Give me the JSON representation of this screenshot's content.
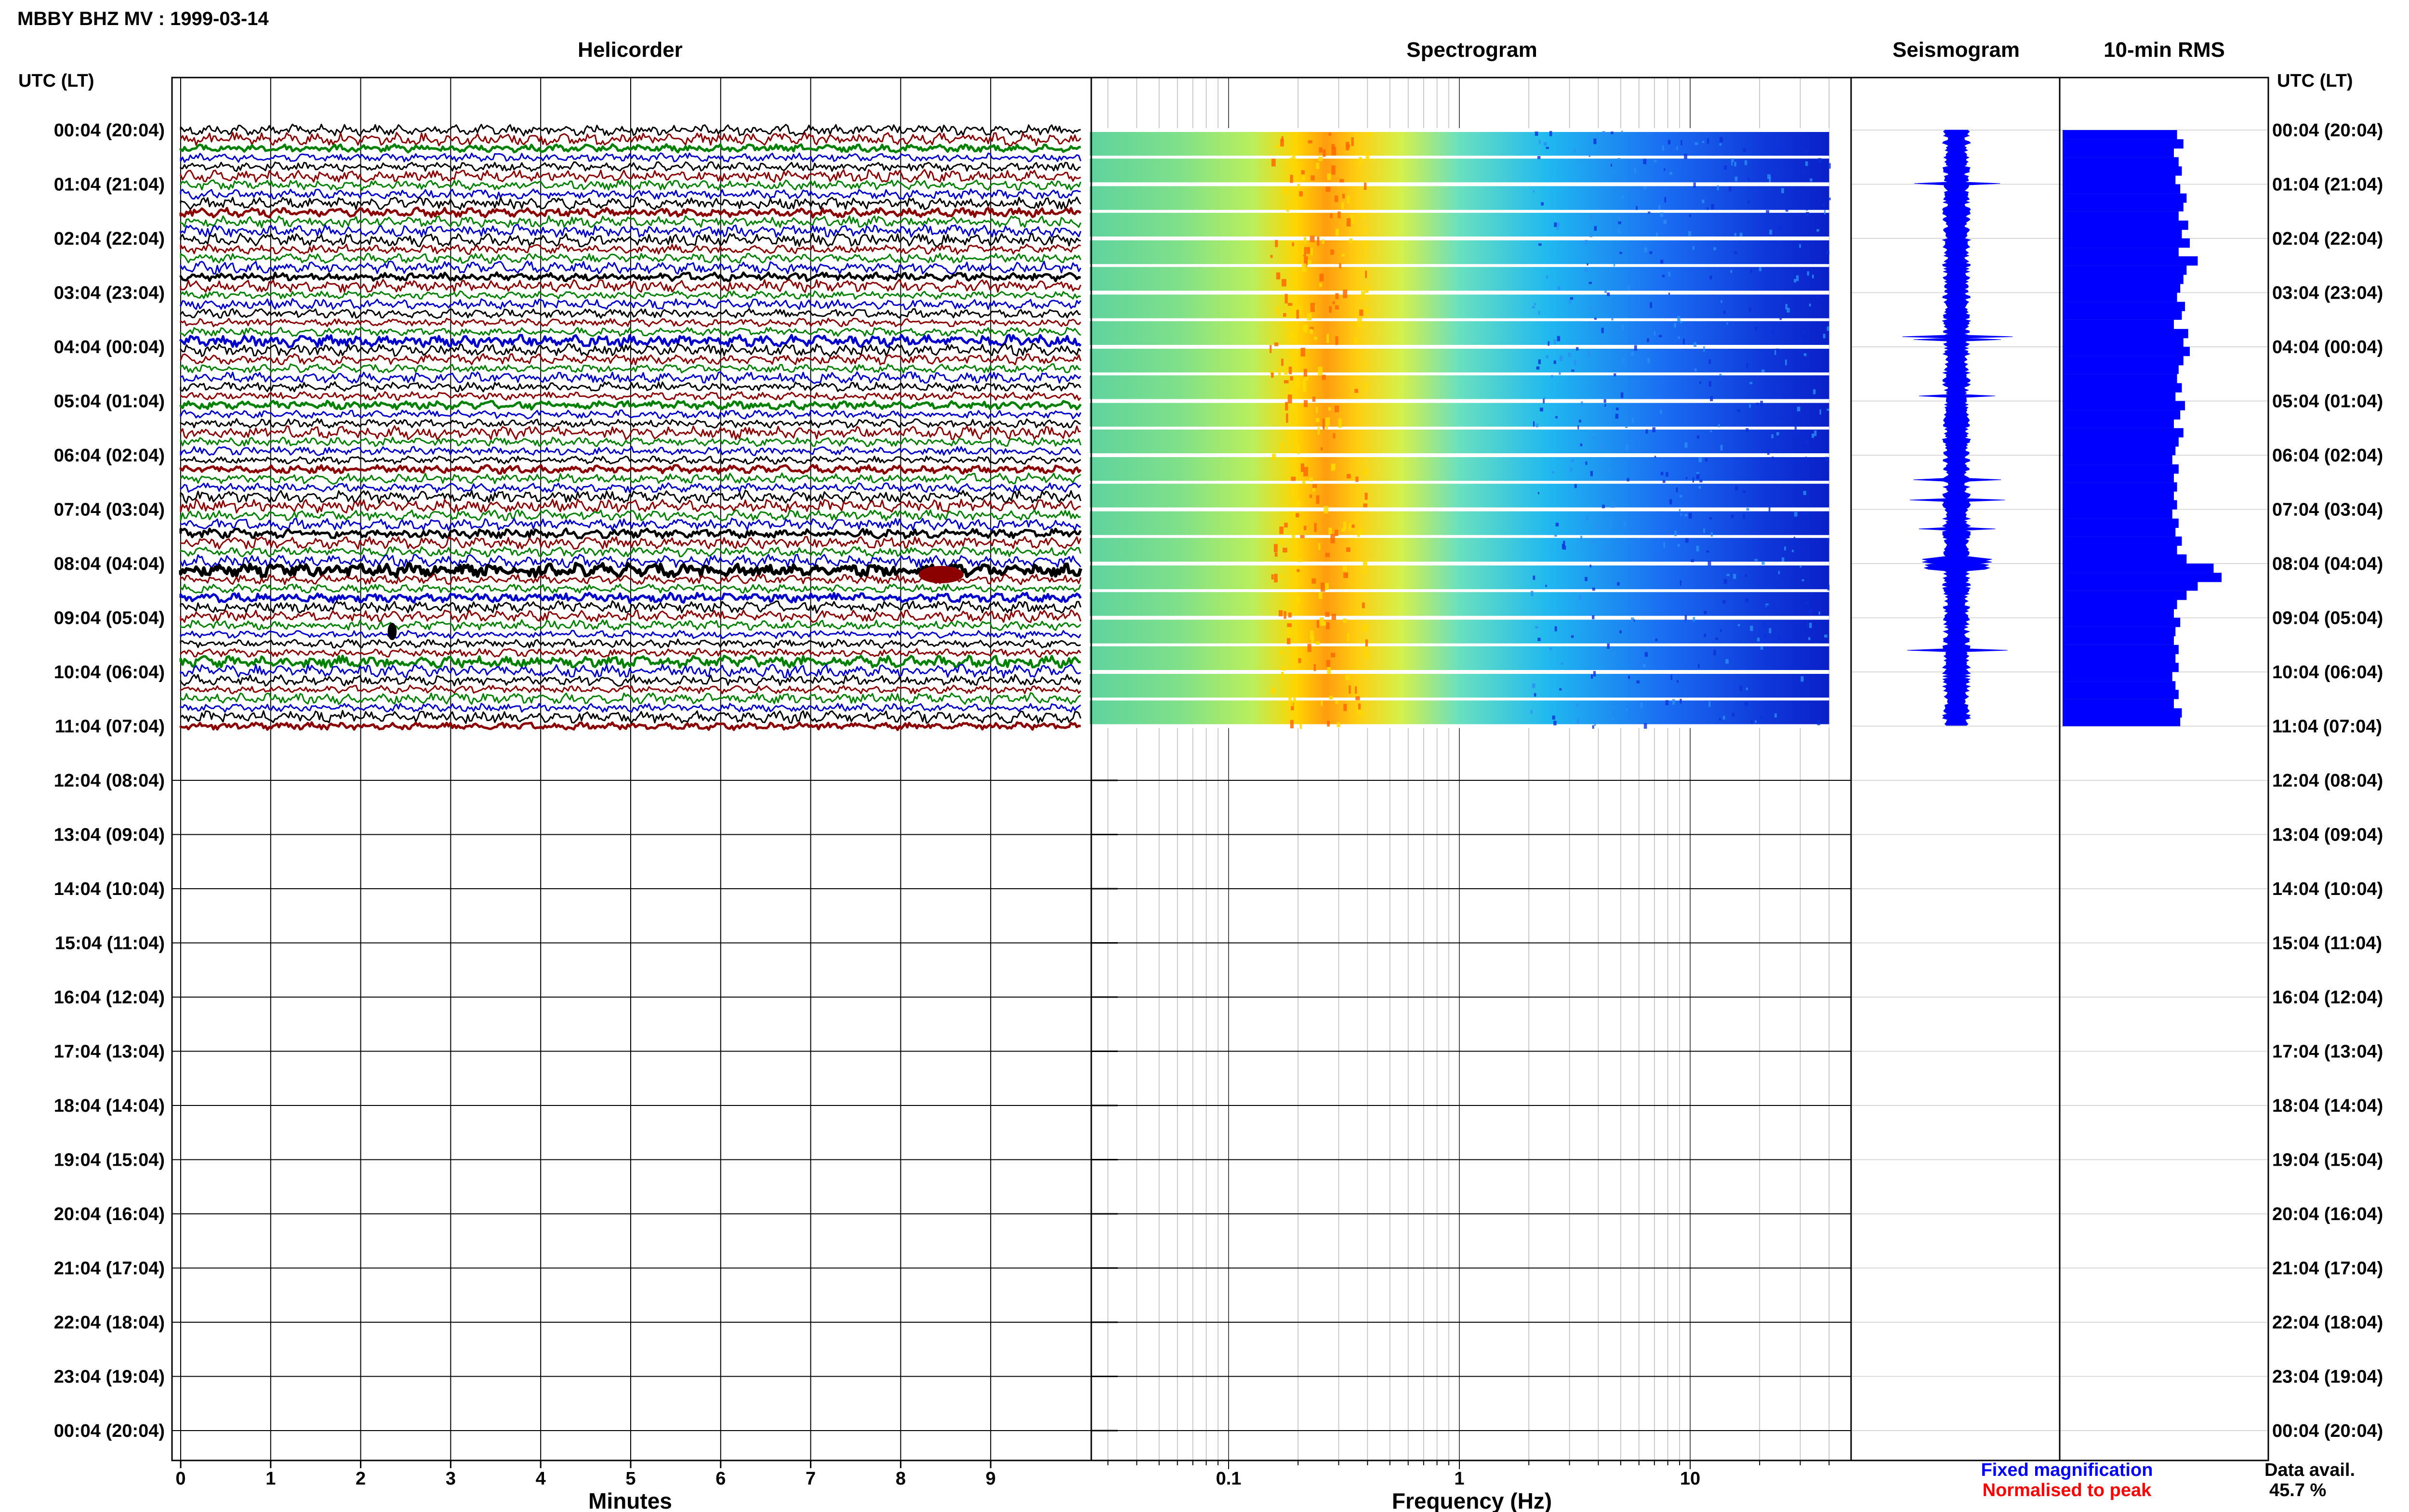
{
  "title": "MBBY BHZ MV : 1999-03-14",
  "time_axis_label": "UTC (LT)",
  "time_labels": [
    "00:04 (20:04)",
    "01:04 (21:04)",
    "02:04 (22:04)",
    "03:04 (23:04)",
    "04:04 (00:04)",
    "05:04 (01:04)",
    "06:04 (02:04)",
    "07:04 (03:04)",
    "08:04 (04:04)",
    "09:04 (05:04)",
    "10:04 (06:04)",
    "11:04 (07:04)",
    "12:04 (08:04)",
    "13:04 (09:04)",
    "14:04 (10:04)",
    "15:04 (11:04)",
    "16:04 (12:04)",
    "17:04 (13:04)",
    "18:04 (14:04)",
    "19:04 (15:04)",
    "20:04 (16:04)",
    "21:04 (17:04)",
    "22:04 (18:04)",
    "23:04 (19:04)",
    "00:04 (20:04)"
  ],
  "legend": {
    "fixed": "Fixed magnification",
    "normalised": "Normalised to peak"
  },
  "data_avail": {
    "label": "Data avail.",
    "value": "45.7 %"
  },
  "colors": {
    "trace_cycle": [
      "#000000",
      "#8b0000",
      "#008000",
      "#0000cd"
    ],
    "seismogram": "#0000ff",
    "rms": "#0000ff"
  },
  "chart_data": [
    {
      "type": "line",
      "title": "Helicorder",
      "xlabel": "Minutes",
      "xlim": [
        0,
        10
      ],
      "x_ticks": [
        "0",
        "1",
        "2",
        "3",
        "4",
        "5",
        "6",
        "7",
        "8",
        "9"
      ],
      "trace_count": 66,
      "data_coverage_hours": [
        0,
        11
      ],
      "notable_events": [
        {
          "hour": 8.0,
          "minute_range": [
            0,
            10
          ],
          "description": "high-amplitude trace"
        },
        {
          "hour": 8.15,
          "minute_range": [
            8.2,
            8.7
          ],
          "description": "burst"
        },
        {
          "hour": 9.2,
          "minute_range": [
            2.3,
            2.4
          ],
          "description": "spike"
        }
      ]
    },
    {
      "type": "heatmap",
      "title": "Spectrogram",
      "xlabel": "Frequency (Hz)",
      "x_scale": "log",
      "xlim": [
        0.025,
        40
      ],
      "x_ticks": [
        "0.1",
        "1",
        "10"
      ],
      "peak_band_hz": [
        0.15,
        0.4
      ],
      "data_coverage_hours": [
        0,
        11
      ]
    },
    {
      "type": "line",
      "title": "Seismogram",
      "data_coverage_hours": [
        0,
        11
      ],
      "peak_hour": 8.0
    },
    {
      "type": "bar",
      "title": "10-min RMS",
      "orientation": "horizontal",
      "hours": [
        0.0,
        0.17,
        0.33,
        0.5,
        0.67,
        0.83,
        1.0,
        1.17,
        1.33,
        1.5,
        1.67,
        1.83,
        2.0,
        2.17,
        2.33,
        2.5,
        2.67,
        2.83,
        3.0,
        3.17,
        3.33,
        3.5,
        3.67,
        3.83,
        4.0,
        4.17,
        4.33,
        4.5,
        4.67,
        4.83,
        5.0,
        5.17,
        5.33,
        5.5,
        5.67,
        5.83,
        6.0,
        6.17,
        6.33,
        6.5,
        6.67,
        6.83,
        7.0,
        7.17,
        7.33,
        7.5,
        7.67,
        7.83,
        8.0,
        8.17,
        8.33,
        8.5,
        8.67,
        8.83,
        9.0,
        9.17,
        9.33,
        9.5,
        9.67,
        9.83,
        10.0,
        10.17,
        10.33,
        10.5,
        10.67,
        10.83
      ],
      "values": [
        0.72,
        0.76,
        0.7,
        0.73,
        0.75,
        0.71,
        0.74,
        0.78,
        0.76,
        0.73,
        0.79,
        0.75,
        0.8,
        0.73,
        0.85,
        0.78,
        0.76,
        0.74,
        0.72,
        0.77,
        0.75,
        0.7,
        0.79,
        0.76,
        0.8,
        0.76,
        0.73,
        0.72,
        0.75,
        0.71,
        0.77,
        0.74,
        0.7,
        0.76,
        0.73,
        0.71,
        0.69,
        0.73,
        0.7,
        0.72,
        0.7,
        0.72,
        0.69,
        0.73,
        0.71,
        0.75,
        0.72,
        0.78,
        0.95,
        1.0,
        0.85,
        0.78,
        0.72,
        0.7,
        0.74,
        0.71,
        0.7,
        0.73,
        0.71,
        0.73,
        0.69,
        0.71,
        0.73,
        0.7,
        0.75,
        0.74
      ],
      "xlim": [
        0,
        1
      ]
    }
  ]
}
